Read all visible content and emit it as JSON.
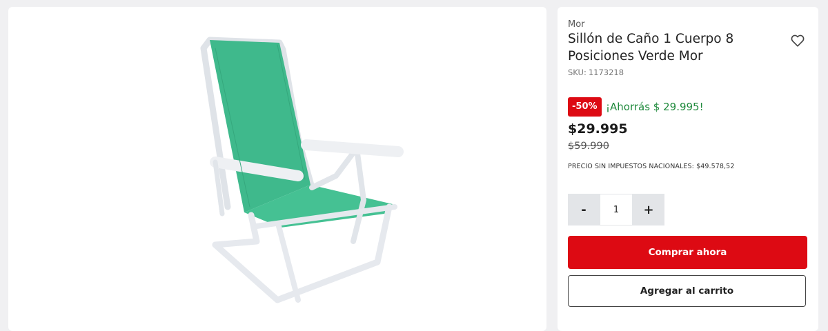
{
  "product": {
    "brand": "Mor",
    "title": "Sillón de Caño 1 Cuerpo 8 Posiciones Verde Mor",
    "sku_label": "SKU:",
    "sku_value": "1173218",
    "image_alt": "Sillón de caño verde",
    "fabric_color": "#3fb98c",
    "frame_color": "#e6e9ee"
  },
  "pricing": {
    "discount_badge": "-50%",
    "savings_text": "¡Ahorrás $ 29.995!",
    "current_price": "$29.995",
    "old_price": "$59.990",
    "tax_note": "PRECIO SIN IMPUESTOS NACIONALES: $49.578,52"
  },
  "quantity": {
    "minus_label": "-",
    "value": "1",
    "plus_label": "+"
  },
  "actions": {
    "buy_now": "Comprar ahora",
    "add_to_cart": "Agregar al carrito"
  },
  "icons": {
    "favorite": "heart-outline-icon"
  },
  "colors": {
    "accent_red": "#dd0a13",
    "savings_green": "#1f8a3c",
    "page_bg": "#f0f0f2"
  }
}
